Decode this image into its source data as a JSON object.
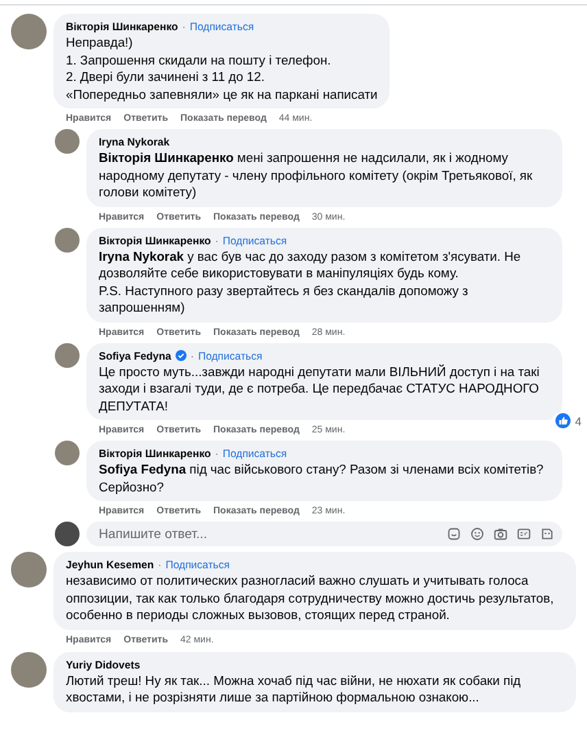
{
  "threads": [
    {
      "comment": {
        "author": "Вікторія Шинкаренко",
        "separator": "·",
        "follow": "Подписаться",
        "verified": false,
        "text": "Неправда!)\n1. Запрошення скидали на пошту і телефон.\n2. Двері були зачинені з 11 до 12.\n«Попередньо запевняли» це як на паркані написати",
        "actions": [
          "Нравится",
          "Ответить",
          "Показать перевод"
        ],
        "time": "44 мин."
      },
      "replies": [
        {
          "author": "Iryna Nykorak",
          "verified": false,
          "text": "**Вікторія Шинкаренко** мені запрошення не надсилали, як і жодному народному депутату - члену профільного комітету (окрім Третьякової, як голови комітету)",
          "actions": [
            "Нравится",
            "Ответить",
            "Показать перевод"
          ],
          "time": "30 мин."
        },
        {
          "author": "Вікторія Шинкаренко",
          "separator": "·",
          "follow": "Подписаться",
          "verified": false,
          "text": "**Iryna Nykorak** у вас був час до заходу разом з комітетом з'ясувати. Не дозволяйте себе використовувати в маніпуляціях будь кому.\nP.S. Наступного разу звертайтесь я без скандалів допоможу з запрошенням)",
          "actions": [
            "Нравится",
            "Ответить",
            "Показать перевод"
          ],
          "time": "28 мин."
        },
        {
          "author": "Sofiya Fedyna",
          "separator": "·",
          "follow": "Подписаться",
          "verified": true,
          "text": "Це просто муть...завжди народні депутати мали ВІЛЬНИЙ доступ і на такі заходи і взагалі туди, де є потреба. Це передбачає СТАТУС НАРОДНОГО ДЕПУТАТА!",
          "actions": [
            "Нравится",
            "Ответить",
            "Показать перевод"
          ],
          "time": "25 мин.",
          "reactions": "4"
        },
        {
          "author": "Вікторія Шинкаренко",
          "separator": "·",
          "follow": "Подписаться",
          "verified": false,
          "text": "**Sofiya Fedyna** під час військового стану? Разом зі членами всіх комітетів? Серйозно?",
          "actions": [
            "Нравится",
            "Ответить",
            "Показать перевод"
          ],
          "time": "23 мин."
        }
      ],
      "reply_box": {
        "placeholder": "Напишите ответ..."
      }
    },
    {
      "comment": {
        "author": "Jeyhun Kesemen",
        "separator": "·",
        "follow": "Подписаться",
        "verified": false,
        "text": "независимо от политических разногласий важно слушать и учитывать голоса оппозиции, так как только благодаря сотрудничеству можно достичь результатов, особенно в периоды сложных вызовов, стоящих перед страной.",
        "actions": [
          "Нравится",
          "Ответить"
        ],
        "time": "42 мин."
      }
    },
    {
      "comment": {
        "author": "Yuriy Didovets",
        "verified": false,
        "text": "Лютий треш! Ну як так... Можна хочаб під час війни, не нюхати як собаки під хвостами, і не розрізняти лише за партійною формальною ознакою..."
      }
    }
  ]
}
